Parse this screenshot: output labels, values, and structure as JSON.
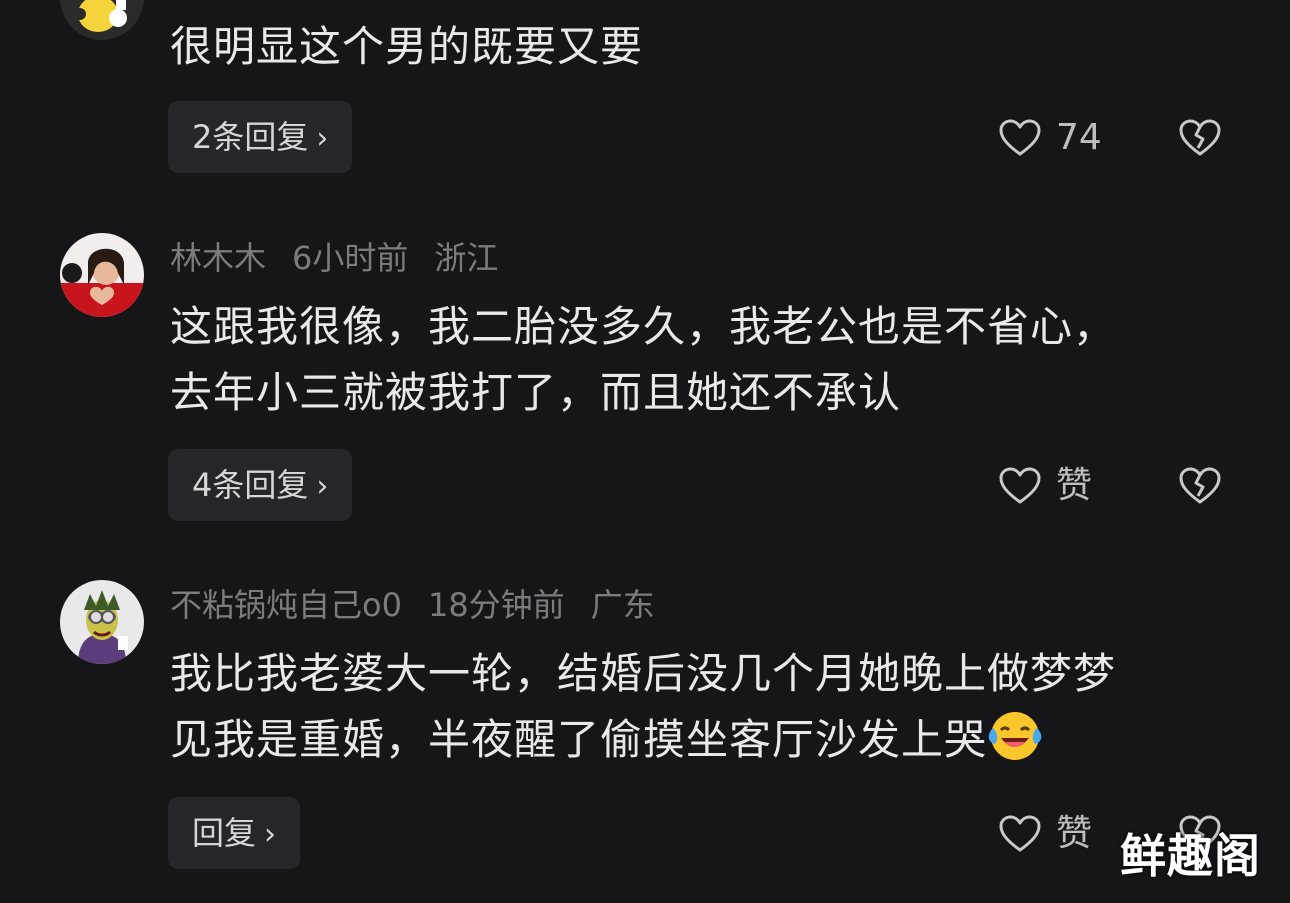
{
  "comments": [
    {
      "text": "很明显这个男的既要又要",
      "reply_label": "2条回复",
      "like_label": "74"
    },
    {
      "username": "林木木",
      "time": "6小时前",
      "location": "浙江",
      "text_line1": "这跟我很像，我二胎没多久，我老公也是不省心，",
      "text_line2": "去年小三就被我打了，而且她还不承认",
      "reply_label": "4条回复",
      "like_label": "赞"
    },
    {
      "username": "不粘锅炖自己o0",
      "time": "18分钟前",
      "location": "广东",
      "text_line1": "我比我老婆大一轮，结婚后没几个月她晚上做梦梦",
      "text_line2": "见我是重婚，半夜醒了偷摸坐客厅沙发上哭",
      "emoji": "laughing-crying-emoji",
      "reply_label": "回复",
      "like_label": "赞"
    }
  ],
  "watermark": "鲜趣阁",
  "icons": {
    "like": "heart-icon",
    "dislike": "broken-heart-icon",
    "chevron": "chevron-right-icon"
  },
  "colors": {
    "background": "#161618",
    "button_bg": "#26262a",
    "meta_text": "#7b7b80",
    "body_text": "#e9e9ea"
  }
}
